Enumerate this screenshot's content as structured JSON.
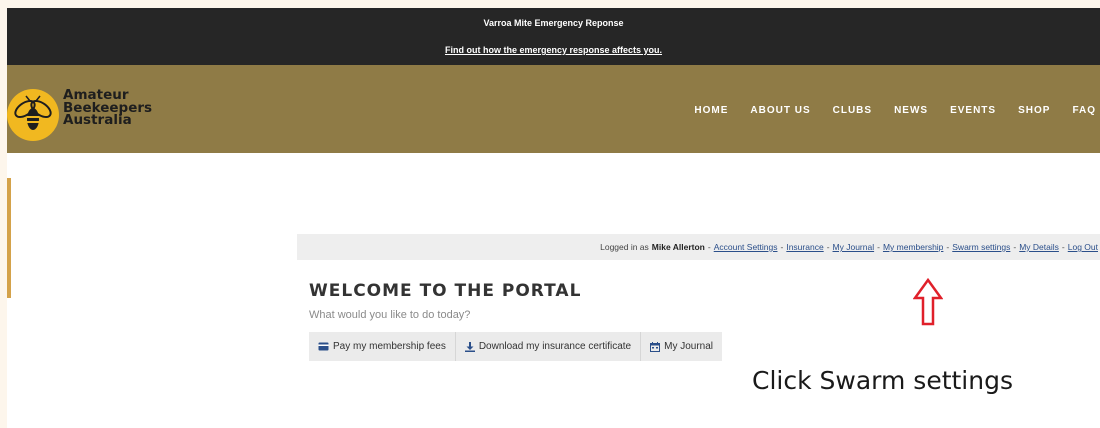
{
  "alert": {
    "title": "Varroa Mite Emergency Reponse",
    "link": "Find out how the emergency response affects you."
  },
  "logo": {
    "line1": "Amateur",
    "line2": "Beekeepers",
    "line3": "Australia",
    "icon": "bee-icon"
  },
  "nav": {
    "items": [
      "HOME",
      "ABOUT US",
      "CLUBS",
      "NEWS",
      "EVENTS",
      "SHOP",
      "FAQ"
    ]
  },
  "login": {
    "prefix": "Logged in as",
    "user": "Mike Allerton",
    "separator": "-",
    "links": [
      "Account Settings",
      "Insurance",
      "My Journal",
      "My membership",
      "Swarm settings",
      "My Details",
      "Log Out"
    ]
  },
  "portal": {
    "title": "WELCOME TO THE PORTAL",
    "subtitle": "What would you like to do today?",
    "buttons": [
      {
        "label": "Pay my membership fees",
        "icon": "credit-card-icon"
      },
      {
        "label": "Download my insurance certificate",
        "icon": "download-icon"
      },
      {
        "label": "My Journal",
        "icon": "calendar-icon"
      }
    ]
  },
  "annotation": {
    "text": "Click Swarm settings",
    "arrow_color": "#e0202a"
  },
  "colors": {
    "alert_bg": "#262626",
    "nav_bg": "#8f7b46",
    "logo_badge": "#f1b820",
    "link": "#2b4f8a"
  }
}
